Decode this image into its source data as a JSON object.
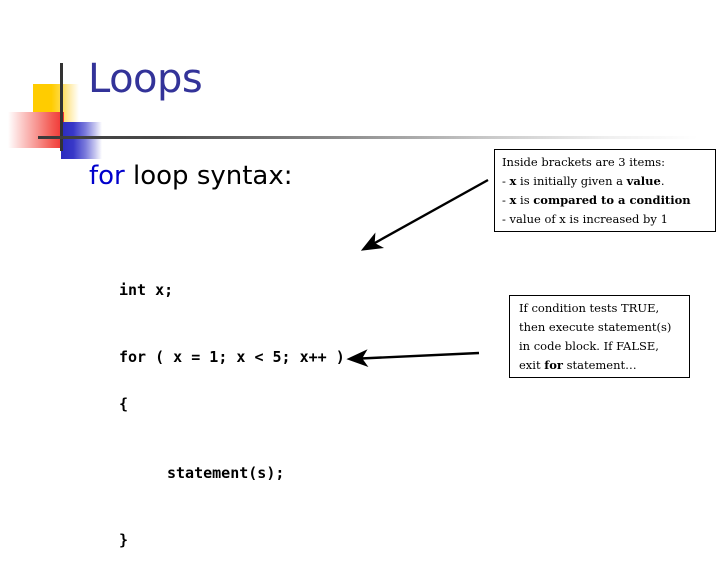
{
  "slide": {
    "title": "Loops",
    "subtitle": {
      "keyword": "for",
      "rest": " loop syntax:"
    },
    "code": {
      "line_1": "int x;",
      "line_2": "for ( x = 1; x < 5; x++ )",
      "line_3": "{",
      "line_4": "statement(s);",
      "line_5": "}"
    },
    "callouts": [
      {
        "id": "brackets-callout",
        "lines": [
          {
            "plain_1": "Inside brackets are 3 items:"
          },
          {
            "plain_1": "- ",
            "bold_1": "x",
            "plain_2": " is initially given a ",
            "bold_2": "value",
            "plain_3": "."
          },
          {
            "plain_1": "- ",
            "bold_1": "x",
            "plain_2": " is ",
            "bold_2": "compared to a condition"
          },
          {
            "plain_1": "- value of x is increased by 1"
          }
        ]
      },
      {
        "id": "condition-callout",
        "lines": [
          {
            "plain_1": "If condition tests TRUE,"
          },
          {
            "plain_1": "then execute statement(s)"
          },
          {
            "plain_1": "in code block. If FALSE,"
          },
          {
            "plain_1": "exit ",
            "bold_1": "for",
            "plain_2": " statement…"
          }
        ]
      }
    ],
    "colors": {
      "title": "#333399",
      "keyword": "#0000CC",
      "text": "#000000",
      "background": "#FFFFFF",
      "deco_yellow": "#FFCC00",
      "deco_red": "#F03030",
      "deco_blue": "#2B2BBE",
      "rule": "#3A3A3A"
    }
  }
}
